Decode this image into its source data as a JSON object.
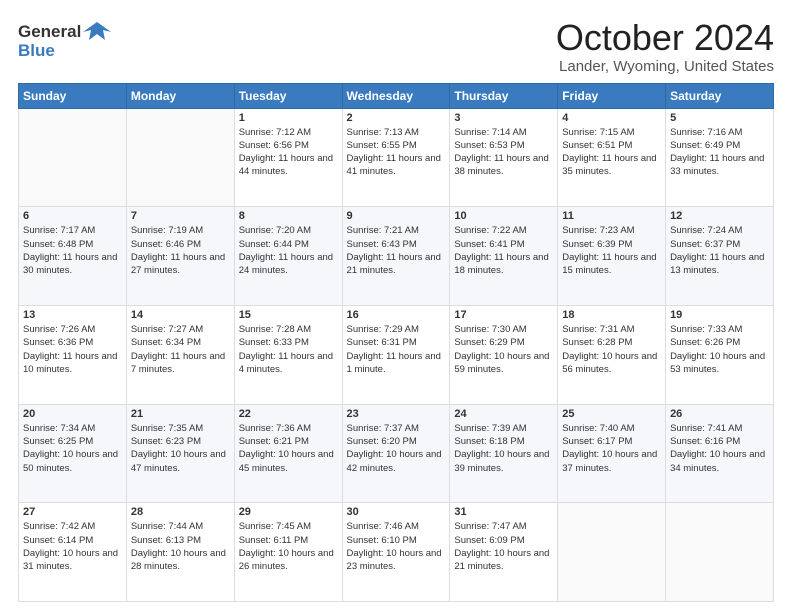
{
  "header": {
    "logo_general": "General",
    "logo_blue": "Blue",
    "title": "October 2024",
    "subtitle": "Lander, Wyoming, United States"
  },
  "days_of_week": [
    "Sunday",
    "Monday",
    "Tuesday",
    "Wednesday",
    "Thursday",
    "Friday",
    "Saturday"
  ],
  "weeks": [
    [
      {
        "day": "",
        "info": ""
      },
      {
        "day": "",
        "info": ""
      },
      {
        "day": "1",
        "info": "Sunrise: 7:12 AM\nSunset: 6:56 PM\nDaylight: 11 hours and 44 minutes."
      },
      {
        "day": "2",
        "info": "Sunrise: 7:13 AM\nSunset: 6:55 PM\nDaylight: 11 hours and 41 minutes."
      },
      {
        "day": "3",
        "info": "Sunrise: 7:14 AM\nSunset: 6:53 PM\nDaylight: 11 hours and 38 minutes."
      },
      {
        "day": "4",
        "info": "Sunrise: 7:15 AM\nSunset: 6:51 PM\nDaylight: 11 hours and 35 minutes."
      },
      {
        "day": "5",
        "info": "Sunrise: 7:16 AM\nSunset: 6:49 PM\nDaylight: 11 hours and 33 minutes."
      }
    ],
    [
      {
        "day": "6",
        "info": "Sunrise: 7:17 AM\nSunset: 6:48 PM\nDaylight: 11 hours and 30 minutes."
      },
      {
        "day": "7",
        "info": "Sunrise: 7:19 AM\nSunset: 6:46 PM\nDaylight: 11 hours and 27 minutes."
      },
      {
        "day": "8",
        "info": "Sunrise: 7:20 AM\nSunset: 6:44 PM\nDaylight: 11 hours and 24 minutes."
      },
      {
        "day": "9",
        "info": "Sunrise: 7:21 AM\nSunset: 6:43 PM\nDaylight: 11 hours and 21 minutes."
      },
      {
        "day": "10",
        "info": "Sunrise: 7:22 AM\nSunset: 6:41 PM\nDaylight: 11 hours and 18 minutes."
      },
      {
        "day": "11",
        "info": "Sunrise: 7:23 AM\nSunset: 6:39 PM\nDaylight: 11 hours and 15 minutes."
      },
      {
        "day": "12",
        "info": "Sunrise: 7:24 AM\nSunset: 6:37 PM\nDaylight: 11 hours and 13 minutes."
      }
    ],
    [
      {
        "day": "13",
        "info": "Sunrise: 7:26 AM\nSunset: 6:36 PM\nDaylight: 11 hours and 10 minutes."
      },
      {
        "day": "14",
        "info": "Sunrise: 7:27 AM\nSunset: 6:34 PM\nDaylight: 11 hours and 7 minutes."
      },
      {
        "day": "15",
        "info": "Sunrise: 7:28 AM\nSunset: 6:33 PM\nDaylight: 11 hours and 4 minutes."
      },
      {
        "day": "16",
        "info": "Sunrise: 7:29 AM\nSunset: 6:31 PM\nDaylight: 11 hours and 1 minute."
      },
      {
        "day": "17",
        "info": "Sunrise: 7:30 AM\nSunset: 6:29 PM\nDaylight: 10 hours and 59 minutes."
      },
      {
        "day": "18",
        "info": "Sunrise: 7:31 AM\nSunset: 6:28 PM\nDaylight: 10 hours and 56 minutes."
      },
      {
        "day": "19",
        "info": "Sunrise: 7:33 AM\nSunset: 6:26 PM\nDaylight: 10 hours and 53 minutes."
      }
    ],
    [
      {
        "day": "20",
        "info": "Sunrise: 7:34 AM\nSunset: 6:25 PM\nDaylight: 10 hours and 50 minutes."
      },
      {
        "day": "21",
        "info": "Sunrise: 7:35 AM\nSunset: 6:23 PM\nDaylight: 10 hours and 47 minutes."
      },
      {
        "day": "22",
        "info": "Sunrise: 7:36 AM\nSunset: 6:21 PM\nDaylight: 10 hours and 45 minutes."
      },
      {
        "day": "23",
        "info": "Sunrise: 7:37 AM\nSunset: 6:20 PM\nDaylight: 10 hours and 42 minutes."
      },
      {
        "day": "24",
        "info": "Sunrise: 7:39 AM\nSunset: 6:18 PM\nDaylight: 10 hours and 39 minutes."
      },
      {
        "day": "25",
        "info": "Sunrise: 7:40 AM\nSunset: 6:17 PM\nDaylight: 10 hours and 37 minutes."
      },
      {
        "day": "26",
        "info": "Sunrise: 7:41 AM\nSunset: 6:16 PM\nDaylight: 10 hours and 34 minutes."
      }
    ],
    [
      {
        "day": "27",
        "info": "Sunrise: 7:42 AM\nSunset: 6:14 PM\nDaylight: 10 hours and 31 minutes."
      },
      {
        "day": "28",
        "info": "Sunrise: 7:44 AM\nSunset: 6:13 PM\nDaylight: 10 hours and 28 minutes."
      },
      {
        "day": "29",
        "info": "Sunrise: 7:45 AM\nSunset: 6:11 PM\nDaylight: 10 hours and 26 minutes."
      },
      {
        "day": "30",
        "info": "Sunrise: 7:46 AM\nSunset: 6:10 PM\nDaylight: 10 hours and 23 minutes."
      },
      {
        "day": "31",
        "info": "Sunrise: 7:47 AM\nSunset: 6:09 PM\nDaylight: 10 hours and 21 minutes."
      },
      {
        "day": "",
        "info": ""
      },
      {
        "day": "",
        "info": ""
      }
    ]
  ]
}
